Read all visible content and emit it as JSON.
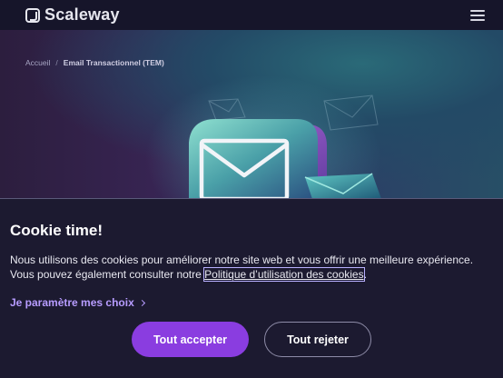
{
  "header": {
    "brand": "Scaleway",
    "logo_icon": "scaleway-logo-icon",
    "menu_icon": "hamburger-menu-icon"
  },
  "breadcrumb": {
    "home": "Accueil",
    "separator": "/",
    "current": "Email Transactionnel (TEM)"
  },
  "hero": {
    "illustration": "envelope-icon"
  },
  "cookie": {
    "title": "Cookie time!",
    "text_before": "Nous utilisons des cookies pour améliorer notre site web et vous offrir une meilleure expérience. Vous pouvez également consulter notre ",
    "policy_link": "Politique d’utilisation des cookies",
    "text_after": ".",
    "settings_label": "Je paramètre mes choix",
    "accept_label": "Tout accepter",
    "reject_label": "Tout rejeter"
  },
  "colors": {
    "accent": "#8a3de0",
    "link": "#b79cff",
    "background": "#1c1a30",
    "topbar": "#16152a"
  }
}
